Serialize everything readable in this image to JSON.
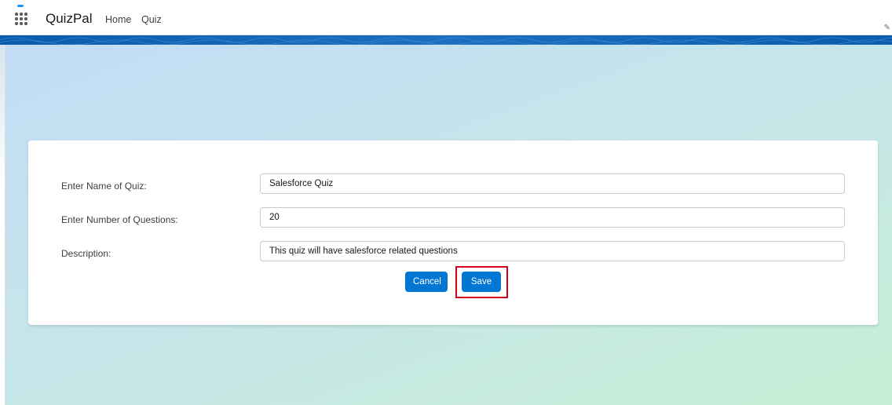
{
  "header": {
    "app_name": "QuizPal",
    "nav": [
      {
        "label": "Home"
      },
      {
        "label": "Quiz"
      }
    ]
  },
  "form": {
    "fields": [
      {
        "label": "Enter Name of Quiz:",
        "value": "Salesforce Quiz"
      },
      {
        "label": "Enter Number of Questions:",
        "value": "20"
      },
      {
        "label": "Description:",
        "value": "This quiz will have salesforce related questions"
      }
    ],
    "cancel_label": "Cancel",
    "save_label": "Save"
  },
  "colors": {
    "brand_blue": "#0176d3",
    "banner_blue": "#0b5cab",
    "highlight_red": "#d0021b"
  }
}
